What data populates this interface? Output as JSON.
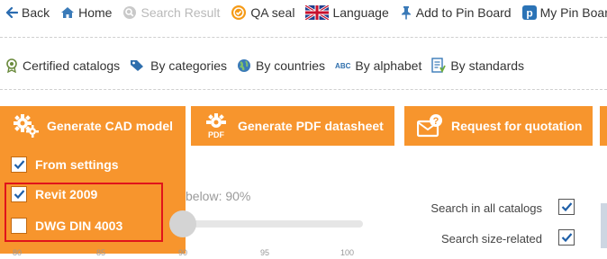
{
  "toolbar": {
    "back": "Back",
    "home": "Home",
    "search_result": "Search Result",
    "qa_seal": "QA seal",
    "language": "Language",
    "add_pin": "Add to Pin Board",
    "my_pin": "My Pin Board"
  },
  "filters": {
    "certified": "Certified catalogs",
    "categories": "By categories",
    "countries": "By countries",
    "alphabet_abbr": "ABC",
    "alphabet": "By alphabet",
    "standards": "By standards"
  },
  "actions": {
    "cad": "Generate CAD model",
    "pdf_icon_text": "PDF",
    "pdf": "Generate PDF datasheet",
    "rfq": "Request for quotation"
  },
  "dropdown": {
    "items": [
      {
        "label": "From settings",
        "checked": true
      },
      {
        "label": "Revit 2009",
        "checked": true
      },
      {
        "label": "DWG DIN 4003",
        "checked": false
      }
    ]
  },
  "slider": {
    "label": "below: 90%",
    "value_percent": 90,
    "ticks": [
      "80",
      "85",
      "90",
      "95",
      "100"
    ]
  },
  "options": {
    "all_catalogs": {
      "label": "Search in all catalogs",
      "checked": true
    },
    "size_related": {
      "label": "Search size-related",
      "checked": true
    }
  },
  "colors": {
    "accent": "#f7952d",
    "highlight": "#e0141b"
  }
}
